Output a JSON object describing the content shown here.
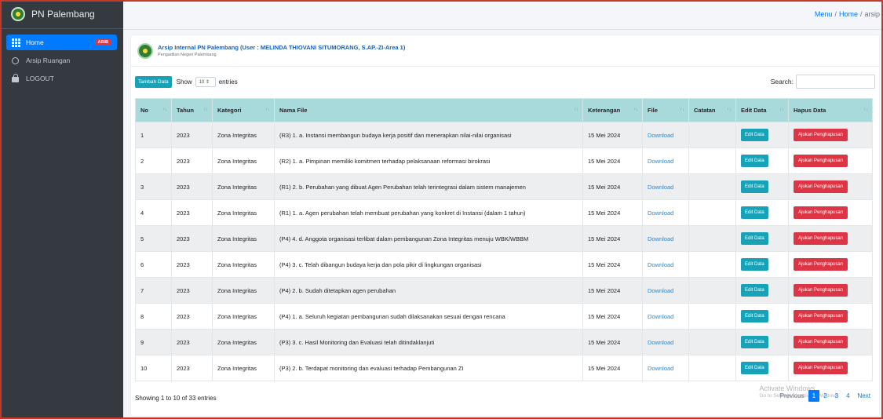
{
  "app": {
    "title": "PN Palembang"
  },
  "sidebar": {
    "items": [
      {
        "label": "Home",
        "badge": "ABIB",
        "icon": "grid-icon"
      },
      {
        "label": "Arsip Ruangan",
        "icon": "circle-icon"
      },
      {
        "label": "LOGOUT",
        "icon": "lock-icon"
      }
    ]
  },
  "breadcrumb": {
    "menu": "Menu",
    "home": "Home",
    "current": "arsip"
  },
  "header": {
    "title": "Arsip Internal PN Palembang (User : MELINDA THIOVANI SITUMORANG, S.AP.-ZI-Area 1)",
    "subtitle": "Pengadilan Negeri Palembang"
  },
  "toolbar": {
    "add_label": "Tambah Data",
    "show_label": "Show",
    "entries_value": "10",
    "entries_label": "entries",
    "search_label": "Search:",
    "search_value": ""
  },
  "table": {
    "columns": [
      "No",
      "Tahun",
      "Kategori",
      "Nama File",
      "Keterangan",
      "File",
      "Catatan",
      "Edit Data",
      "Hapus Data"
    ],
    "rows": [
      {
        "no": "1",
        "tahun": "2023",
        "kategori": "Zona Integritas",
        "nama": "(R3) 1. a. Instansi membangun budaya kerja positif dan menerapkan nilai-nilai organisasi",
        "ket": "15 Mei 2024",
        "file": "Download",
        "catatan": "",
        "edit": "Edit Data",
        "hapus": "Ajukan Penghapusan"
      },
      {
        "no": "2",
        "tahun": "2023",
        "kategori": "Zona Integritas",
        "nama": "(R2) 1. a. Pimpinan memiliki komitmen terhadap pelaksanaan reformasi birokrasi",
        "ket": "15 Mei 2024",
        "file": "Download",
        "catatan": "",
        "edit": "Edit Data",
        "hapus": "Ajukan Penghapusan"
      },
      {
        "no": "3",
        "tahun": "2023",
        "kategori": "Zona Integritas",
        "nama": "(R1) 2. b. Perubahan yang dibuat Agen Perubahan telah terintegrasi dalam sistem manajemen",
        "ket": "15 Mei 2024",
        "file": "Download",
        "catatan": "",
        "edit": "Edit Data",
        "hapus": "Ajukan Penghapusan"
      },
      {
        "no": "4",
        "tahun": "2023",
        "kategori": "Zona Integritas",
        "nama": "(R1) 1. a. Agen perubahan telah membuat perubahan yang konkret di Instansi (dalam 1 tahun)",
        "ket": "15 Mei 2024",
        "file": "Download",
        "catatan": "",
        "edit": "Edit Data",
        "hapus": "Ajukan Penghapusan"
      },
      {
        "no": "5",
        "tahun": "2023",
        "kategori": "Zona Integritas",
        "nama": "(P4) 4. d. Anggota organisasi terlibat dalam pembangunan Zona Integritas menuju WBK/WBBM",
        "ket": "15 Mei 2024",
        "file": "Download",
        "catatan": "",
        "edit": "Edit Data",
        "hapus": "Ajukan Penghapusan"
      },
      {
        "no": "6",
        "tahun": "2023",
        "kategori": "Zona Integritas",
        "nama": "(P4) 3. c. Telah dibangun budaya kerja dan pola pikir di lingkungan organisasi",
        "ket": "15 Mei 2024",
        "file": "Download",
        "catatan": "",
        "edit": "Edit Data",
        "hapus": "Ajukan Penghapusan"
      },
      {
        "no": "7",
        "tahun": "2023",
        "kategori": "Zona Integritas",
        "nama": "(P4) 2. b. Sudah ditetapkan agen perubahan",
        "ket": "15 Mei 2024",
        "file": "Download",
        "catatan": "",
        "edit": "Edit Data",
        "hapus": "Ajukan Penghapusan"
      },
      {
        "no": "8",
        "tahun": "2023",
        "kategori": "Zona Integritas",
        "nama": "(P4) 1. a. Seluruh kegiatan pembangunan sudah dilaksanakan sesuai dengan rencana",
        "ket": "15 Mei 2024",
        "file": "Download",
        "catatan": "",
        "edit": "Edit Data",
        "hapus": "Ajukan Penghapusan"
      },
      {
        "no": "9",
        "tahun": "2023",
        "kategori": "Zona Integritas",
        "nama": "(P3) 3. c. Hasil Monitoring dan Evaluasi telah ditindaklanjuti",
        "ket": "15 Mei 2024",
        "file": "Download",
        "catatan": "",
        "edit": "Edit Data",
        "hapus": "Ajukan Penghapusan"
      },
      {
        "no": "10",
        "tahun": "2023",
        "kategori": "Zona Integritas",
        "nama": "(P3) 2. b. Terdapat monitoring dan evaluasi terhadap Pembangunan ZI",
        "ket": "15 Mei 2024",
        "file": "Download",
        "catatan": "",
        "edit": "Edit Data",
        "hapus": "Ajukan Penghapusan"
      }
    ]
  },
  "footer": {
    "info": "Showing 1 to 10 of 33 entries",
    "pagination": {
      "previous": "Previous",
      "pages": [
        "1",
        "2",
        "3",
        "4"
      ],
      "current": "1",
      "next": "Next"
    }
  },
  "watermark": {
    "line1": "Activate Windows",
    "line2": "Go to Settings to activate Windows."
  },
  "colors": {
    "sidebar": "#343a40",
    "primary": "#007bff",
    "info": "#17a2b8",
    "danger": "#dc3545",
    "table_header": "#a8dadc"
  }
}
